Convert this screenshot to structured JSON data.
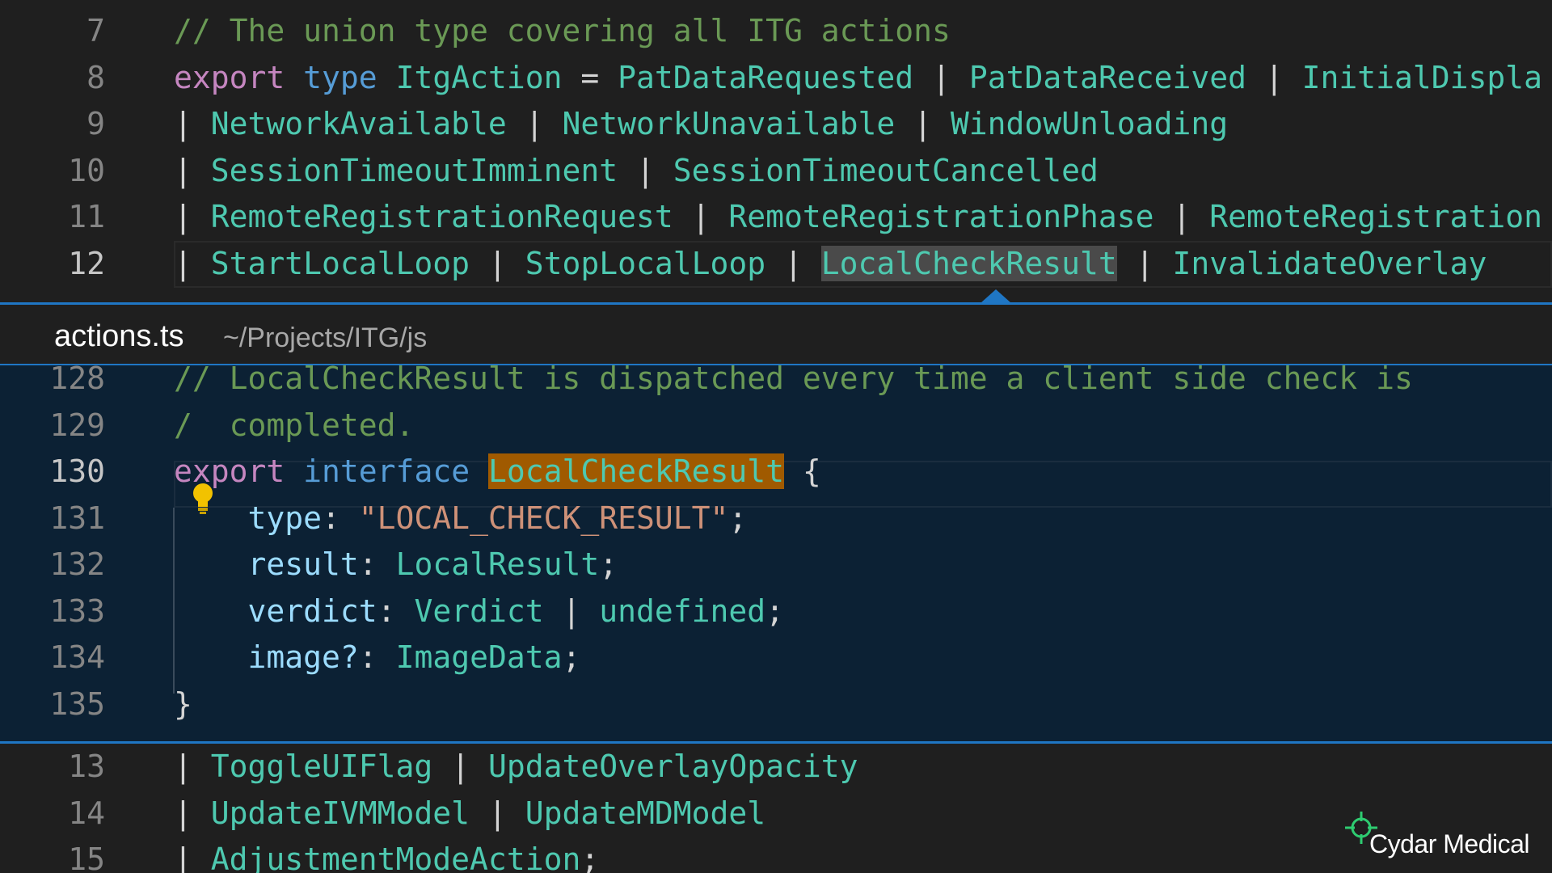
{
  "editor": {
    "top_lines": [
      {
        "num": "7",
        "tokens": [
          {
            "c": "c",
            "t": "// The union type covering all ITG actions"
          }
        ]
      },
      {
        "num": "8",
        "tokens": [
          {
            "c": "k",
            "t": "export"
          },
          {
            "c": "p",
            "t": " "
          },
          {
            "c": "kb",
            "t": "type"
          },
          {
            "c": "p",
            "t": " "
          },
          {
            "c": "t",
            "t": "ItgAction"
          },
          {
            "c": "p",
            "t": " = "
          },
          {
            "c": "t",
            "t": "PatDataRequested"
          },
          {
            "c": "p",
            "t": " | "
          },
          {
            "c": "t",
            "t": "PatDataReceived"
          },
          {
            "c": "p",
            "t": " | "
          },
          {
            "c": "t",
            "t": "InitialDispla"
          }
        ]
      },
      {
        "num": "9",
        "tokens": [
          {
            "c": "p",
            "t": "| "
          },
          {
            "c": "t",
            "t": "NetworkAvailable"
          },
          {
            "c": "p",
            "t": " | "
          },
          {
            "c": "t",
            "t": "NetworkUnavailable"
          },
          {
            "c": "p",
            "t": " | "
          },
          {
            "c": "t",
            "t": "WindowUnloading"
          }
        ]
      },
      {
        "num": "10",
        "tokens": [
          {
            "c": "p",
            "t": "| "
          },
          {
            "c": "t",
            "t": "SessionTimeoutImminent"
          },
          {
            "c": "p",
            "t": " | "
          },
          {
            "c": "t",
            "t": "SessionTimeoutCancelled"
          }
        ]
      },
      {
        "num": "11",
        "tokens": [
          {
            "c": "p",
            "t": "| "
          },
          {
            "c": "t",
            "t": "RemoteRegistrationRequest"
          },
          {
            "c": "p",
            "t": " | "
          },
          {
            "c": "t",
            "t": "RemoteRegistrationPhase"
          },
          {
            "c": "p",
            "t": " | "
          },
          {
            "c": "t",
            "t": "RemoteRegistration"
          }
        ]
      },
      {
        "num": "12",
        "current": true,
        "tokens": [
          {
            "c": "p",
            "t": "| "
          },
          {
            "c": "t",
            "t": "StartLocalLoop"
          },
          {
            "c": "p",
            "t": " | "
          },
          {
            "c": "t",
            "t": "StopLocalLoop"
          },
          {
            "c": "p",
            "t": " | "
          },
          {
            "c": "t hl-ref",
            "t": "LocalCheckResult"
          },
          {
            "c": "p",
            "t": " | "
          },
          {
            "c": "t",
            "t": "InvalidateOverlay"
          }
        ]
      }
    ],
    "bottom_lines": [
      {
        "num": "13",
        "tokens": [
          {
            "c": "p",
            "t": "| "
          },
          {
            "c": "t",
            "t": "ToggleUIFlag"
          },
          {
            "c": "p",
            "t": " | "
          },
          {
            "c": "t",
            "t": "UpdateOverlayOpacity"
          }
        ]
      },
      {
        "num": "14",
        "tokens": [
          {
            "c": "p",
            "t": "| "
          },
          {
            "c": "t",
            "t": "UpdateIVMModel"
          },
          {
            "c": "p",
            "t": " | "
          },
          {
            "c": "t",
            "t": "UpdateMDModel"
          }
        ]
      },
      {
        "num": "15",
        "tokens": [
          {
            "c": "p",
            "t": "| "
          },
          {
            "c": "t",
            "t": "AdjustmentModeAction"
          },
          {
            "c": "p",
            "t": ";"
          }
        ]
      }
    ]
  },
  "peek": {
    "filename": "actions.ts",
    "filepath": "~/Projects/ITG/js",
    "lines": [
      {
        "num": "128",
        "tokens": [
          {
            "c": "c",
            "t": "// LocalCheckResult is dispatched every time a client side check is"
          }
        ]
      },
      {
        "num": "129",
        "tokens": [
          {
            "c": "c",
            "t": "/  completed."
          }
        ]
      },
      {
        "num": "130",
        "current": true,
        "tokens": [
          {
            "c": "k",
            "t": "export"
          },
          {
            "c": "p",
            "t": " "
          },
          {
            "c": "kb",
            "t": "interface"
          },
          {
            "c": "p",
            "t": " "
          },
          {
            "c": "hl-def",
            "t": "LocalCheckResult"
          },
          {
            "c": "p",
            "t": " {"
          }
        ]
      },
      {
        "num": "131",
        "tokens": [
          {
            "c": "p",
            "t": "    "
          },
          {
            "c": "pr",
            "t": "type"
          },
          {
            "c": "p",
            "t": ": "
          },
          {
            "c": "s",
            "t": "\"LOCAL_CHECK_RESULT\""
          },
          {
            "c": "p",
            "t": ";"
          }
        ]
      },
      {
        "num": "132",
        "tokens": [
          {
            "c": "p",
            "t": "    "
          },
          {
            "c": "pr",
            "t": "result"
          },
          {
            "c": "p",
            "t": ": "
          },
          {
            "c": "t",
            "t": "LocalResult"
          },
          {
            "c": "p",
            "t": ";"
          }
        ]
      },
      {
        "num": "133",
        "tokens": [
          {
            "c": "p",
            "t": "    "
          },
          {
            "c": "pr",
            "t": "verdict"
          },
          {
            "c": "p",
            "t": ": "
          },
          {
            "c": "t",
            "t": "Verdict"
          },
          {
            "c": "p",
            "t": " | "
          },
          {
            "c": "t",
            "t": "undefined"
          },
          {
            "c": "p",
            "t": ";"
          }
        ]
      },
      {
        "num": "134",
        "tokens": [
          {
            "c": "p",
            "t": "    "
          },
          {
            "c": "pr",
            "t": "image?"
          },
          {
            "c": "p",
            "t": ": "
          },
          {
            "c": "t",
            "t": "ImageData"
          },
          {
            "c": "p",
            "t": ";"
          }
        ]
      },
      {
        "num": "135",
        "tokens": [
          {
            "c": "p",
            "t": "}"
          }
        ]
      }
    ]
  },
  "icons": {
    "lightbulb": "lightbulb-icon",
    "logo_mark": "crosshair-icon"
  },
  "colors": {
    "peek_border": "#1f76c4",
    "peek_bg": "#0c2134",
    "editor_bg": "#1f1f1f",
    "lightbulb": "#f2c200",
    "logo_accent": "#2ecc71"
  },
  "brand": {
    "name": "Cydar Medical"
  }
}
